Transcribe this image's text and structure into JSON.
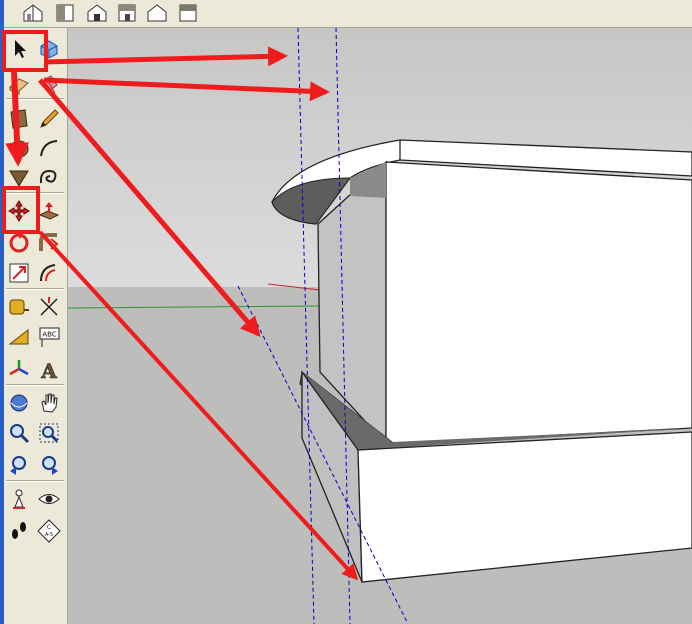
{
  "views_toolbar": {
    "buttons": [
      "iso-view-icon",
      "top-view-icon",
      "front-view-icon",
      "right-view-icon",
      "back-view-icon",
      "left-view-icon"
    ]
  },
  "tools": {
    "select": "select-arrow-icon",
    "component": "make-component-icon",
    "paint": "paint-bucket-icon",
    "eraser": "eraser-icon",
    "rectangle": "rectangle-icon",
    "line": "pencil-icon",
    "circle": "circle-icon",
    "arc": "arc-icon",
    "polygon": "polygon-icon",
    "freehand": "freehand-icon",
    "move": "move-icon",
    "pushpull": "push-pull-icon",
    "rotate": "rotate-icon",
    "followme": "follow-me-icon",
    "scale": "scale-icon",
    "offset": "offset-icon",
    "tape": "tape-measure-icon",
    "dimension": "dimension-icon",
    "protractor": "protractor-icon",
    "text": "text-icon",
    "axes": "axes-icon",
    "text3d": "3d-text-icon",
    "orbit": "orbit-icon",
    "pan": "pan-hand-icon",
    "zoom": "zoom-icon",
    "zoom_window": "zoom-window-icon",
    "previous": "previous-view-icon",
    "next": "next-view-icon",
    "position_camera": "position-camera-icon",
    "look_around": "look-around-eye-icon",
    "walk": "walk-footprints-icon",
    "section": "section-plane-icon"
  },
  "text3d_glyph": "A",
  "text_tool_glyph": "ABC",
  "section_glyph_top": "C",
  "section_glyph_bottom": "A-5",
  "annotation_color": "#ee1c1c",
  "guide_color": "#0000cc",
  "status_mark": "1"
}
